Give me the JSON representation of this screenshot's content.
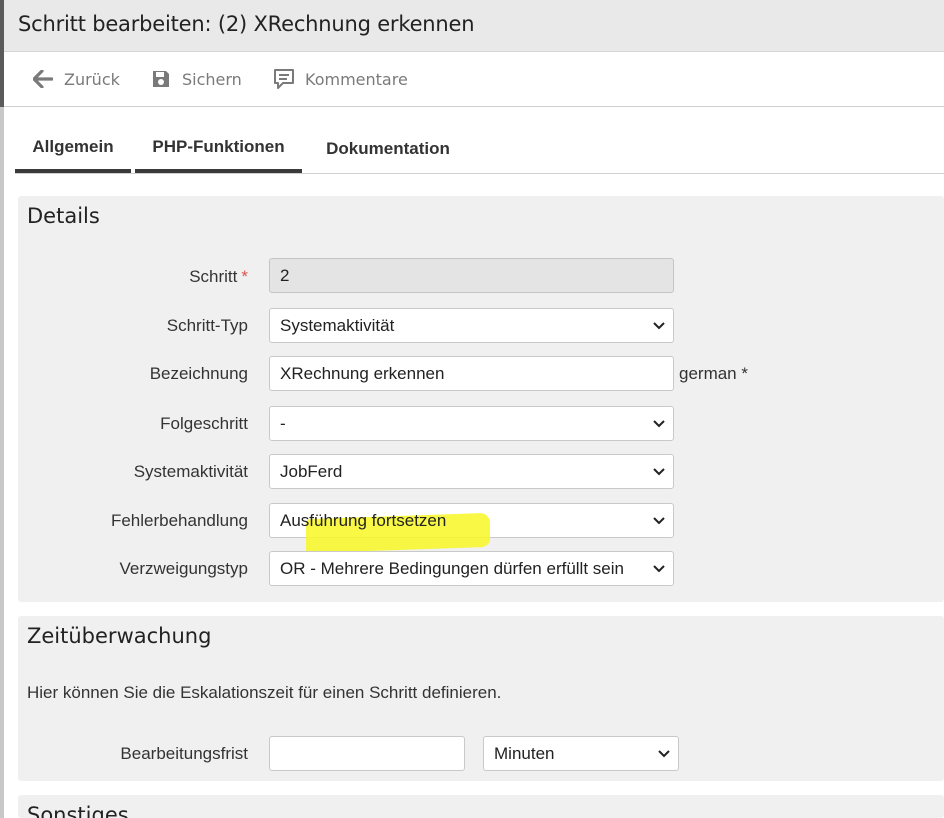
{
  "window": {
    "title": "Schritt bearbeiten: (2) XRechnung erkennen"
  },
  "toolbar": {
    "back_label": "Zurück",
    "save_label": "Sichern",
    "comments_label": "Kommentare"
  },
  "tabs": [
    {
      "label": "Allgemein",
      "active": true
    },
    {
      "label": "PHP-Funktionen",
      "active": false
    },
    {
      "label": "Dokumentation",
      "active": false
    }
  ],
  "details": {
    "heading": "Details",
    "fields": {
      "schritt": {
        "label": "Schritt",
        "required_mark": "*",
        "value": "2"
      },
      "schritt_typ": {
        "label": "Schritt-Typ",
        "value": "Systemaktivität"
      },
      "bezeichnung": {
        "label": "Bezeichnung",
        "value": "XRechnung erkennen",
        "suffix": "german *"
      },
      "folgeschritt": {
        "label": "Folgeschritt",
        "value": "-"
      },
      "systemaktivitaet": {
        "label": "Systemaktivität",
        "value": "JobFerd"
      },
      "fehlerbehandlung": {
        "label": "Fehlerbehandlung",
        "value": "Ausführung fortsetzen"
      },
      "verzweigungstyp": {
        "label": "Verzweigungstyp",
        "value": "OR - Mehrere Bedingungen dürfen erfüllt sein"
      }
    }
  },
  "zeitueberwachung": {
    "heading": "Zeitüberwachung",
    "description": "Hier können Sie die Eskalationszeit für einen Schritt definieren.",
    "bearbeitungsfrist": {
      "label": "Bearbeitungsfrist",
      "value": "",
      "unit": "Minuten"
    }
  },
  "sonstiges": {
    "heading": "Sonstiges"
  },
  "colors": {
    "highlight": "#f7f724",
    "required": "#d9534f",
    "panel_bg": "#f0f0f0"
  },
  "icons": [
    "arrow-left-icon",
    "floppy-disk-icon",
    "comment-icon",
    "chevron-down-icon"
  ]
}
